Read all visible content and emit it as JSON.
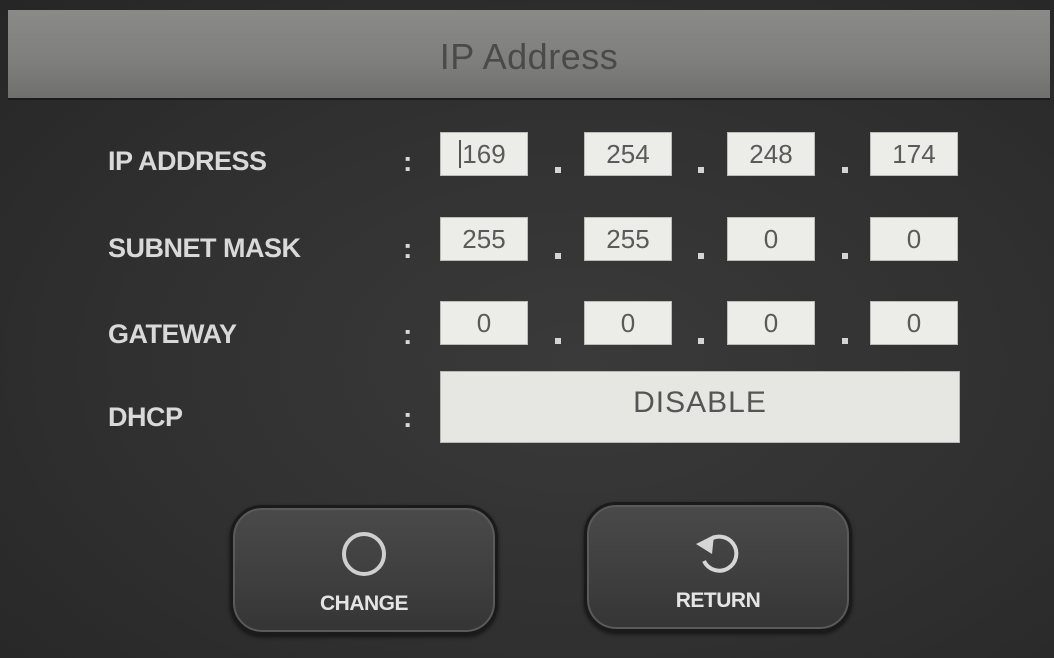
{
  "title": "IP Address",
  "colon": ":",
  "rows": [
    {
      "label": "IP ADDRESS",
      "octets": [
        "169",
        "254",
        "248",
        "174"
      ]
    },
    {
      "label": "SUBNET MASK",
      "octets": [
        "255",
        "255",
        "0",
        "0"
      ]
    },
    {
      "label": "GATEWAY",
      "octets": [
        "0",
        "0",
        "0",
        "0"
      ]
    }
  ],
  "dhcp": {
    "label": "DHCP",
    "value": "DISABLE"
  },
  "buttons": {
    "change": {
      "label": "CHANGE",
      "icon": "circle-icon"
    },
    "return": {
      "label": "RETURN",
      "icon": "return-arrow-icon"
    }
  },
  "colors": {
    "title_bar": "#7e7e7c",
    "background": "#303030",
    "field": "#ecece8",
    "label_text": "#d9d9d9"
  }
}
